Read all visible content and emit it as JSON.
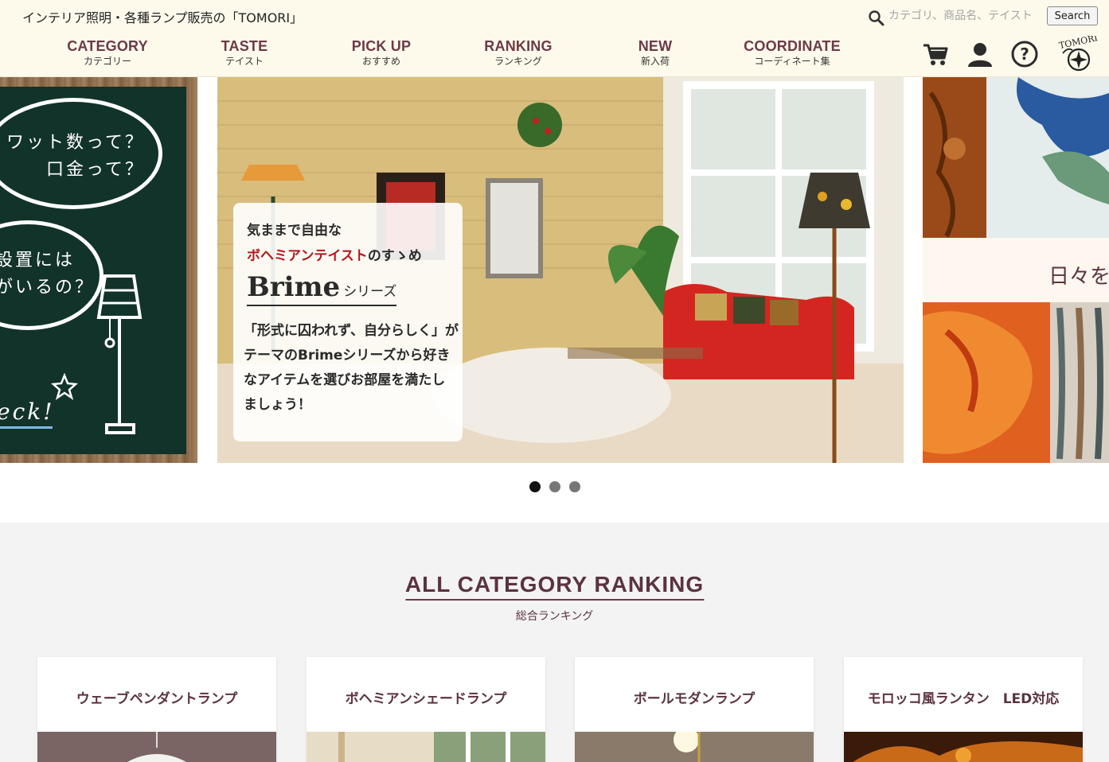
{
  "header": {
    "tagline": "インテリア照明・各種ランプ販売の「TOMORI」",
    "search_placeholder": "カテゴリ、商品名、テイスト",
    "search_button": "Search"
  },
  "nav": {
    "items": [
      {
        "en": "CATEGORY",
        "ja": "カテゴリー"
      },
      {
        "en": "TASTE",
        "ja": "テイスト"
      },
      {
        "en": "PICK UP",
        "ja": "おすすめ"
      },
      {
        "en": "RANKING",
        "ja": "ランキング"
      },
      {
        "en": "NEW",
        "ja": "新入荷"
      },
      {
        "en": "COORDINATE",
        "ja": "コーディネート集"
      }
    ],
    "icons": [
      "cart-icon",
      "user-icon",
      "help-icon",
      "tomori-logo"
    ],
    "logo_text": "TOMORI"
  },
  "carousel": {
    "left_slide": {
      "line1": "ワット数って？",
      "line2": "口金って？",
      "line3": "設置には",
      "line4": "がいるの？",
      "line5": "eck!"
    },
    "main_slide": {
      "line1": "気ままで自由な",
      "line2_highlight": "ボヘミアンテイスト",
      "line2_rest": "のすゝめ",
      "brand": "Brime",
      "brand_suffix": "シリーズ",
      "description": "「形式に囚われず、自分らしく」がテーマのBrimeシリーズから好きなアイテムを選びお部屋を満たしましょう！"
    },
    "right_slide": {
      "text": "日々を"
    },
    "dots": 3,
    "active_dot": 0
  },
  "ranking": {
    "title": "ALL CATEGORY RANKING",
    "subtitle": "総合ランキング",
    "cards": [
      {
        "name": "ウェーブペンダントランプ"
      },
      {
        "name": "ボヘミアンシェードランプ"
      },
      {
        "name": "ボールモダンランプ"
      },
      {
        "name": "モロッコ風ランタン　LED対応"
      }
    ]
  },
  "colors": {
    "header_bg": "#fdfaec",
    "brand": "#6b3a47",
    "accent_red": "#b0191e"
  }
}
